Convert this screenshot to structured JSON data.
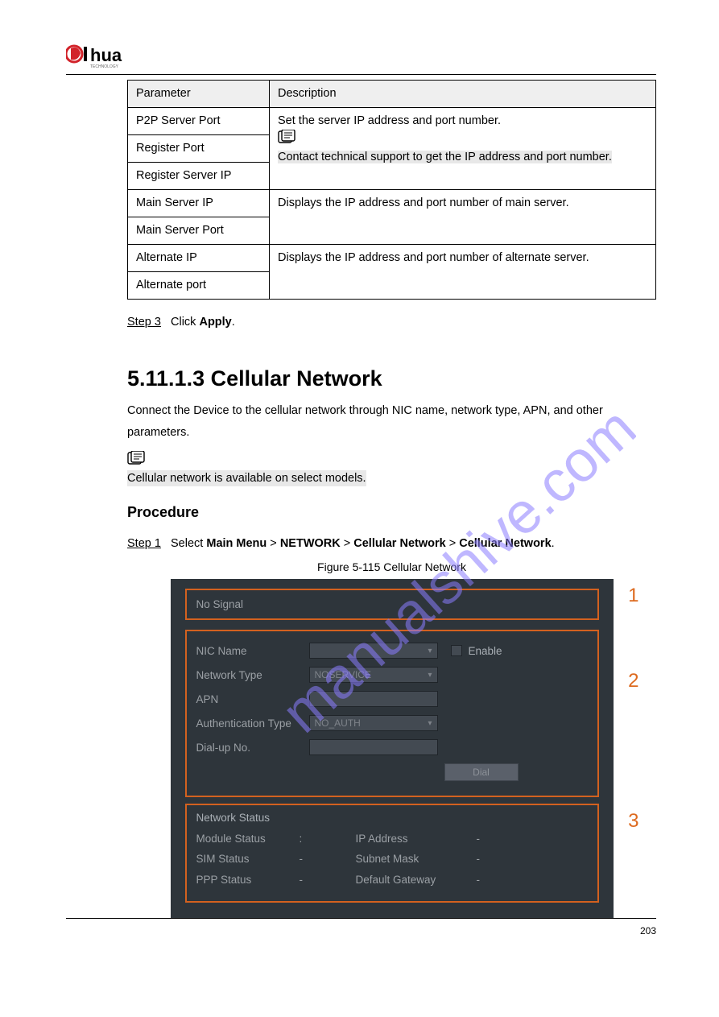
{
  "logo_text": "alhua",
  "logo_sub": "TECHNOLOGY",
  "table": {
    "h1": "Parameter",
    "h2": "Description",
    "r1c1": "P2P Server Port",
    "r2c1": "Register Port",
    "r2_desc_line1": "Set the server IP address and port number.",
    "r2_note": "Contact technical support to get the IP address and port number.",
    "r3c1": "Register Server IP",
    "r4c1": "Main Server IP",
    "r4_desc": "Displays the IP address and port number of main server.",
    "r5c1": "Main Server Port",
    "r6c1": "Alternate IP",
    "r6_desc": "Displays the IP address and port number of alternate server.",
    "r7c1": "Alternate port"
  },
  "step3_lbl": "Step 3",
  "step3_txt": "Click ",
  "step3_apply": "Apply",
  "step3_end": ".",
  "sec_num": "5.11.1.3 ",
  "sec_ttl": "Cellular Network",
  "sec_p1a": "Connect the Device to the cellular network through NIC name, network type, APN, and other",
  "sec_p1b": "parameters.",
  "sec_note": "Cellular network is available on select models.",
  "proc": "Procedure",
  "s1_lbl": "Step 1",
  "s1_a": "Select ",
  "s1_b": "Main Menu",
  "s1_c": " > ",
  "s1_d": "NETWORK",
  "s1_e": " > ",
  "s1_f": "Cellular Network",
  "s1_g": " > ",
  "s1_h": "Cellular Network",
  "s1_i": ".",
  "fig_cap": "Figure 5-115 Cellular Network",
  "ui": {
    "signal": "No Signal",
    "nic": "NIC Name",
    "enable": "Enable",
    "ntype": "Network Type",
    "ntype_v": "NOSERVICE",
    "apn": "APN",
    "auth": "Authentication Type",
    "auth_v": "NO_AUTH",
    "dial": "Dial-up No.",
    "dialbtn": "Dial",
    "nstat": "Network Status",
    "mod": "Module Status",
    "sim": "SIM Status",
    "ppp": "PPP Status",
    "ip": "IP Address",
    "mask": "Subnet Mask",
    "gw": "Default Gateway",
    "colon": ":",
    "dash": "-",
    "num1": "1",
    "num2": "2",
    "num3": "3"
  },
  "pagenum": "203",
  "watermark": "manualshive.com"
}
